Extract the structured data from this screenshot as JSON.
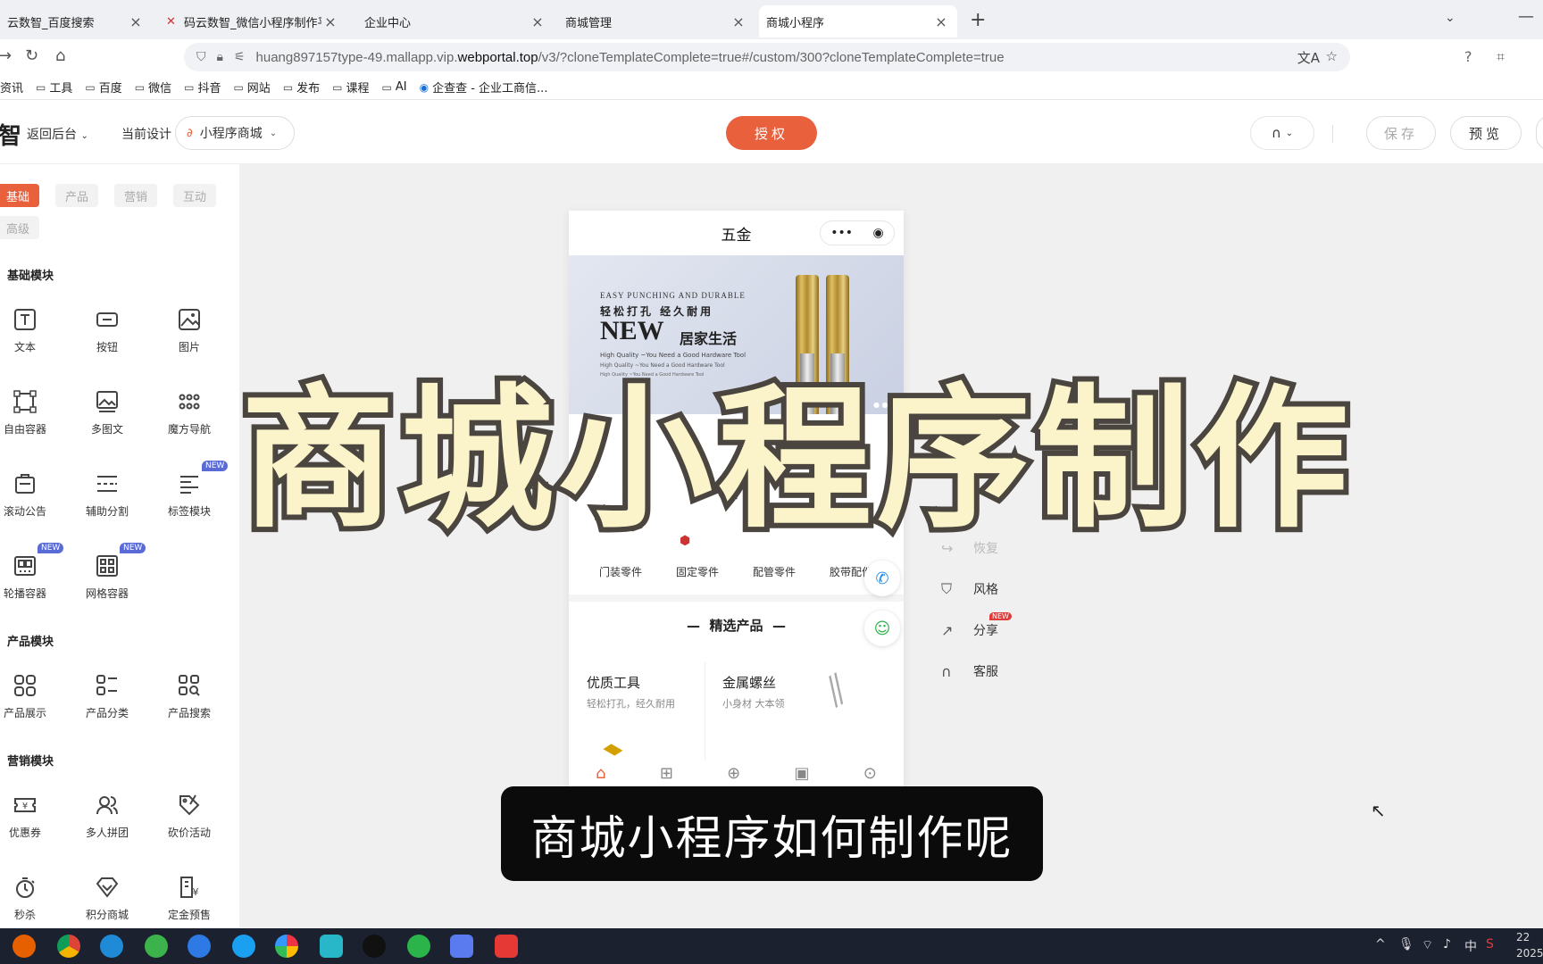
{
  "browser": {
    "tabs": [
      {
        "title": "云数智_百度搜索"
      },
      {
        "title": "码云数智_微信小程序制作平台_"
      },
      {
        "title": "企业中心"
      },
      {
        "title": "商城管理"
      },
      {
        "title": "商城小程序"
      }
    ],
    "url_prefix": "huang897157type-49.mallapp.vip.",
    "url_domain": "webportal.top",
    "url_suffix": "/v3/?cloneTemplateComplete=true#/custom/300?cloneTemplateComplete=true",
    "bookmarks": [
      "资讯",
      "工具",
      "百度",
      "微信",
      "抖音",
      "网站",
      "发布",
      "课程",
      "AI",
      "企查查 - 企业工商信..."
    ]
  },
  "header": {
    "logo_char": "智",
    "back_label": "返回后台",
    "current_design_label": "当前设计",
    "design_select_value": "小程序商城",
    "auth_label": "授权",
    "save_label": "保存",
    "preview_label": "预览"
  },
  "left_panel": {
    "tabs": [
      "基础",
      "产品",
      "营销",
      "互动",
      "高级"
    ],
    "sections": [
      {
        "title": "基础模块",
        "items": [
          "文本",
          "按钮",
          "图片",
          "自由容器",
          "多图文",
          "魔方导航",
          "滚动公告",
          "辅助分割",
          "标签模块",
          "轮播容器",
          "网格容器"
        ]
      },
      {
        "title": "产品模块",
        "items": [
          "产品展示",
          "产品分类",
          "产品搜索"
        ]
      },
      {
        "title": "营销模块",
        "items": [
          "优惠券",
          "多人拼团",
          "砍价活动",
          "秒杀",
          "积分商城",
          "定金预售"
        ]
      }
    ],
    "new_badge": "NEW"
  },
  "phone": {
    "title": "五金",
    "banner": {
      "line1": "EASY PUNCHING AND DURABLE",
      "line2": "轻松打孔   经久耐用",
      "line3": "NEW",
      "line4": "居家生活",
      "line5": "High Quality ~You Need a Good Hardware Tool",
      "line6": "High Quality ~You Need a Good Hardware Tool",
      "line7": "High Quality ~You Need a Good Hardware Tool"
    },
    "categories": [
      "门装零件",
      "固定零件",
      "配管零件",
      "胶带配件"
    ],
    "selected_title": "精选产品",
    "products": [
      {
        "title": "优质工具",
        "sub": "轻松打孔，经久耐用"
      },
      {
        "title": "金属螺丝",
        "sub": "小身材 大本领"
      }
    ]
  },
  "side_tools": [
    {
      "label": "恢复",
      "icon": "restore-icon"
    },
    {
      "label": "风格",
      "icon": "shirt-icon"
    },
    {
      "label": "分享",
      "icon": "share-icon",
      "badge": "NEW"
    },
    {
      "label": "客服",
      "icon": "headset-icon"
    }
  ],
  "overlay": {
    "big_caption": "商城小程序制作",
    "subtitle": "商城小程序如何制作呢"
  },
  "taskbar": {
    "ime": "中",
    "time": "22",
    "date": "2025"
  },
  "colors": {
    "accent": "#e8603c",
    "badge": "#5b6bd6"
  }
}
